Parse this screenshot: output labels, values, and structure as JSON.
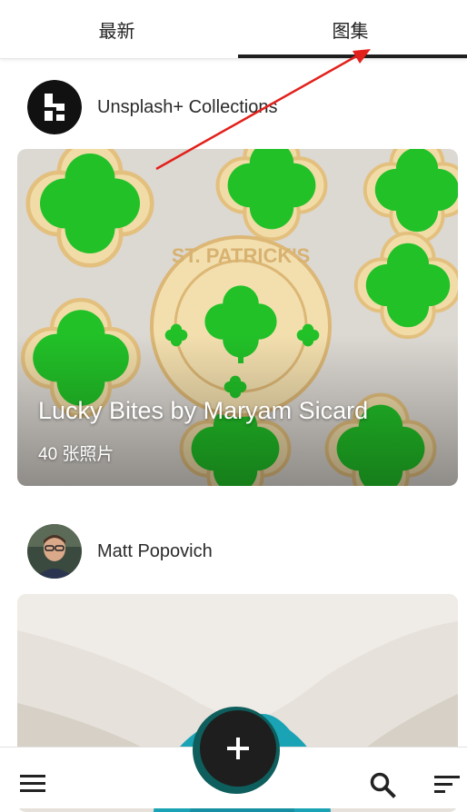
{
  "tabs": [
    {
      "label": "最新",
      "active": false
    },
    {
      "label": "图集",
      "active": true
    }
  ],
  "collections": [
    {
      "author": "Unsplash+ Collections",
      "title": "Lucky Bites by Maryam Sicard",
      "count_label": "40 张照片"
    },
    {
      "author": "Matt Popovich"
    }
  ],
  "bottom_nav": {
    "menu_icon": "menu-icon",
    "add_icon": "plus-icon",
    "search_icon": "search-icon",
    "sort_icon": "sort-icon"
  },
  "colors": {
    "tab_underline": "#1f1f1f",
    "fab": "#1e1e1e",
    "fab_ring": "#0d5e5c",
    "cookie_green": "#22c128",
    "annotation_arrow": "#e3201b"
  }
}
